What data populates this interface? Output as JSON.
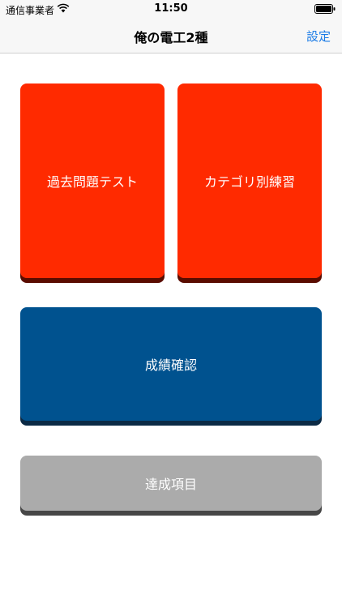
{
  "status_bar": {
    "carrier": "通信事業者",
    "time": "11:50"
  },
  "nav": {
    "title": "俺の電工2種",
    "settings_label": "設定",
    "settings_color": "#1a7be6"
  },
  "menu": {
    "past_exam_label": "過去問題テスト",
    "category_practice_label": "カテゴリ別練習",
    "results_label": "成績確認",
    "achievements_label": "達成項目"
  },
  "colors": {
    "primary_red": "#ff2a00",
    "primary_blue": "#00528f",
    "disabled_gray": "#ababab"
  }
}
